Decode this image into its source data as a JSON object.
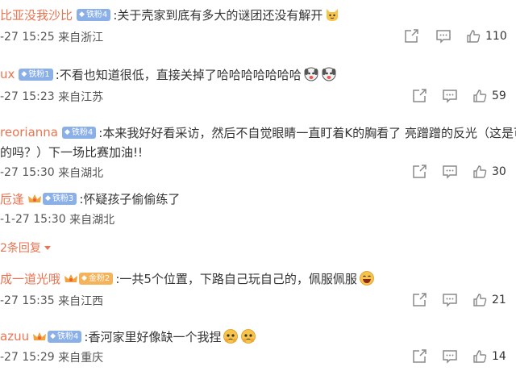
{
  "comments": [
    {
      "name": "比亚没我沙比",
      "badge": "铁粉4",
      "text": ":关于壳家到底有多大的谜团还没有解开",
      "time": "-27 15:25",
      "location": "来自浙江",
      "likes": "110",
      "emoji": "cat"
    },
    {
      "name": "ux",
      "badge": "铁粉1",
      "text": ":不看也知道很低，直接关掉了哈哈哈哈哈哈哈",
      "time": "-27 15:23",
      "location": "来自江苏",
      "likes": "59",
      "emoji": "dog"
    },
    {
      "name": "reorianna",
      "badge": "铁粉4",
      "text": ":本来我好好看采访，然后不自觉眼睛一直盯着K的胸看了 亮蹭蹭的反光（这是可",
      "text2": "的吗？）下一场比赛加油!!",
      "time": "-27 15:30",
      "location": "来自湖北",
      "likes": "30"
    },
    {
      "name": "卮逢",
      "badge": "铁粉3",
      "text": ":怀疑孩子偷偷练了",
      "time": "-1-27 15:30",
      "location": "来自湖北"
    },
    {
      "more_label": "2条回复"
    },
    {
      "name": "成一道光哦",
      "badge": "金粉2",
      "text": ":一共5个位置，下路自己玩自己的，佩服佩服",
      "time": "-27 15:35",
      "location": "来自江西",
      "likes": "21"
    },
    {
      "name": "azuu",
      "badge": "铁粉4",
      "text": ":香河家里好像缺一个我捏",
      "time": "-27 15:29",
      "location": "来自重庆",
      "likes": "14"
    }
  ],
  "colors": {
    "name": "#eb7350",
    "badge_iron": "#8bb0e8",
    "badge_gold": "#f4b35a",
    "icon": "#8a8a8a"
  },
  "icons": [
    "share-icon",
    "comment-icon",
    "like-icon",
    "diamond-icon",
    "crown-icon"
  ]
}
